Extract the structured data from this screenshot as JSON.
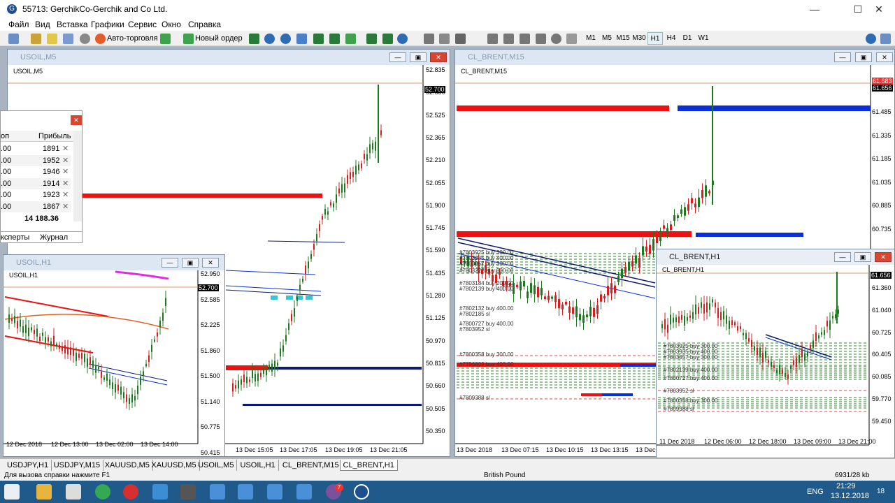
{
  "window": {
    "title": "55713: GerchikCo-Gerchik and Co Ltd.",
    "app_icon": "G"
  },
  "menu": [
    "Файл",
    "Вид",
    "Вставка",
    "Графики",
    "Сервис",
    "Окно",
    "Справка"
  ],
  "toolbar": {
    "autotrading_label": "Авто-торговля",
    "new_order_label": "Новый ордер",
    "timeframes": [
      "M1",
      "M5",
      "M15",
      "M30",
      "H1",
      "H4",
      "D1",
      "W1"
    ],
    "active_timeframe": "H1"
  },
  "charts": {
    "usoil_m5": {
      "window_title": "USOIL,M5",
      "symbol_label": "USOIL,M5",
      "current_price": "52.700",
      "price_labels": [
        "52.835",
        "52.680",
        "52.525",
        "52.365",
        "52.210",
        "52.055",
        "51.900",
        "51.745",
        "51.590",
        "51.435",
        "51.280",
        "51.125",
        "50.970",
        "50.815",
        "50.660",
        "50.505",
        "50.350"
      ],
      "time_labels": [
        "13 Dec 15:05",
        "13 Dec 17:05",
        "13 Dec 19:05",
        "13 Dec 21:05"
      ]
    },
    "usoil_h1": {
      "window_title": "USOIL,H1",
      "symbol_label": "USOIL,H1",
      "current_price": "52.700",
      "price_labels": [
        "52.950",
        "52.585",
        "52.225",
        "51.860",
        "51.500",
        "51.140",
        "50.775",
        "50.415"
      ],
      "time_labels": [
        "12 Dec 2018",
        "12 Dec 13:00",
        "13 Dec 02:00",
        "13 Dec 14:00"
      ]
    },
    "cl_brent_m15": {
      "window_title": "CL_BRENT,M15",
      "symbol_label": "CL_BRENT,M15",
      "current_price": "61.656",
      "prev_price": "61.683",
      "price_labels": [
        "61.485",
        "61.335",
        "61.185",
        "61.035",
        "60.885",
        "60.735"
      ],
      "time_labels": [
        "13 Dec 2018",
        "13 Dec 07:15",
        "13 Dec 10:15",
        "13 Dec 13:15",
        "13 Dec"
      ],
      "orders": [
        "#7803925 buy 300.00",
        "#7803935 buy 400.00",
        "#7803857 buy 300.00",
        "#7803222 buy 300.00",
        "#7803184 buy 200.00",
        "#7802139 buy 400.00",
        "#7802132 buy 400.00",
        "#7802185 sl",
        "#7800727 buy 400.00",
        "#7803952 sl",
        "#7800358 buy 300.00",
        "#7796809 buy 400.00",
        "#7809388 sl"
      ]
    },
    "cl_brent_h1": {
      "window_title": "CL_BRENT,H1",
      "symbol_label": "CL_BRENT,H1",
      "current_price": "61.656",
      "price_labels": [
        "61.360",
        "61.040",
        "60.725",
        "60.405",
        "60.085",
        "59.770",
        "59.450"
      ],
      "time_labels": [
        "11 Dec 2018",
        "12 Dec 06:00",
        "12 Dec 18:00",
        "13 Dec 09:00",
        "13 Dec 21:00"
      ],
      "orders": [
        "#7803925 buy 300.00",
        "#7803935 buy 400.00",
        "#7803857 buy 300.00",
        "#7802139 buy 400.00",
        "#7800727 buy 400.00",
        "#7803952 sl",
        "#7800358 buy 300.00",
        "#7809388 sl"
      ]
    }
  },
  "trade_panel": {
    "col_stop": "оп",
    "col_profit": "Прибыль",
    "rows": [
      {
        "stop": ".00",
        "profit": "1891"
      },
      {
        "stop": ".00",
        "profit": "1952"
      },
      {
        "stop": ".00",
        "profit": "1946"
      },
      {
        "stop": ".00",
        "profit": "1914"
      },
      {
        "stop": ".00",
        "profit": "1923"
      },
      {
        "stop": ".00",
        "profit": "1867"
      }
    ],
    "total": "14 188.36",
    "tabs": [
      "ксперты",
      "Журнал"
    ]
  },
  "chart_tabs": [
    "USDJPY,H1",
    "USDJPY,M15",
    "XAUUSD,M5",
    "XAUUSD,M5",
    "USOIL,M5",
    "USOIL,H1",
    "CL_BRENT,M15",
    "CL_BRENT,H1"
  ],
  "active_chart_tab": "CL_BRENT,H1",
  "status": {
    "help": "Для вызова справки нажмите F1",
    "profile": "British Pound",
    "traffic": "6931/28 kb"
  },
  "taskbar": {
    "lang": "ENG",
    "time": "21:29",
    "date": "13.12.2018",
    "notif_count": "18",
    "viber_badge": "7"
  },
  "colors": {
    "bull": "#1b7a1b",
    "bear": "#d91c1c",
    "level_red": "#ee1111",
    "level_blue": "#0a2fd9",
    "level_navy": "#0d1b6e",
    "magenta": "#e22ee0",
    "cyan": "#33c7d6"
  }
}
